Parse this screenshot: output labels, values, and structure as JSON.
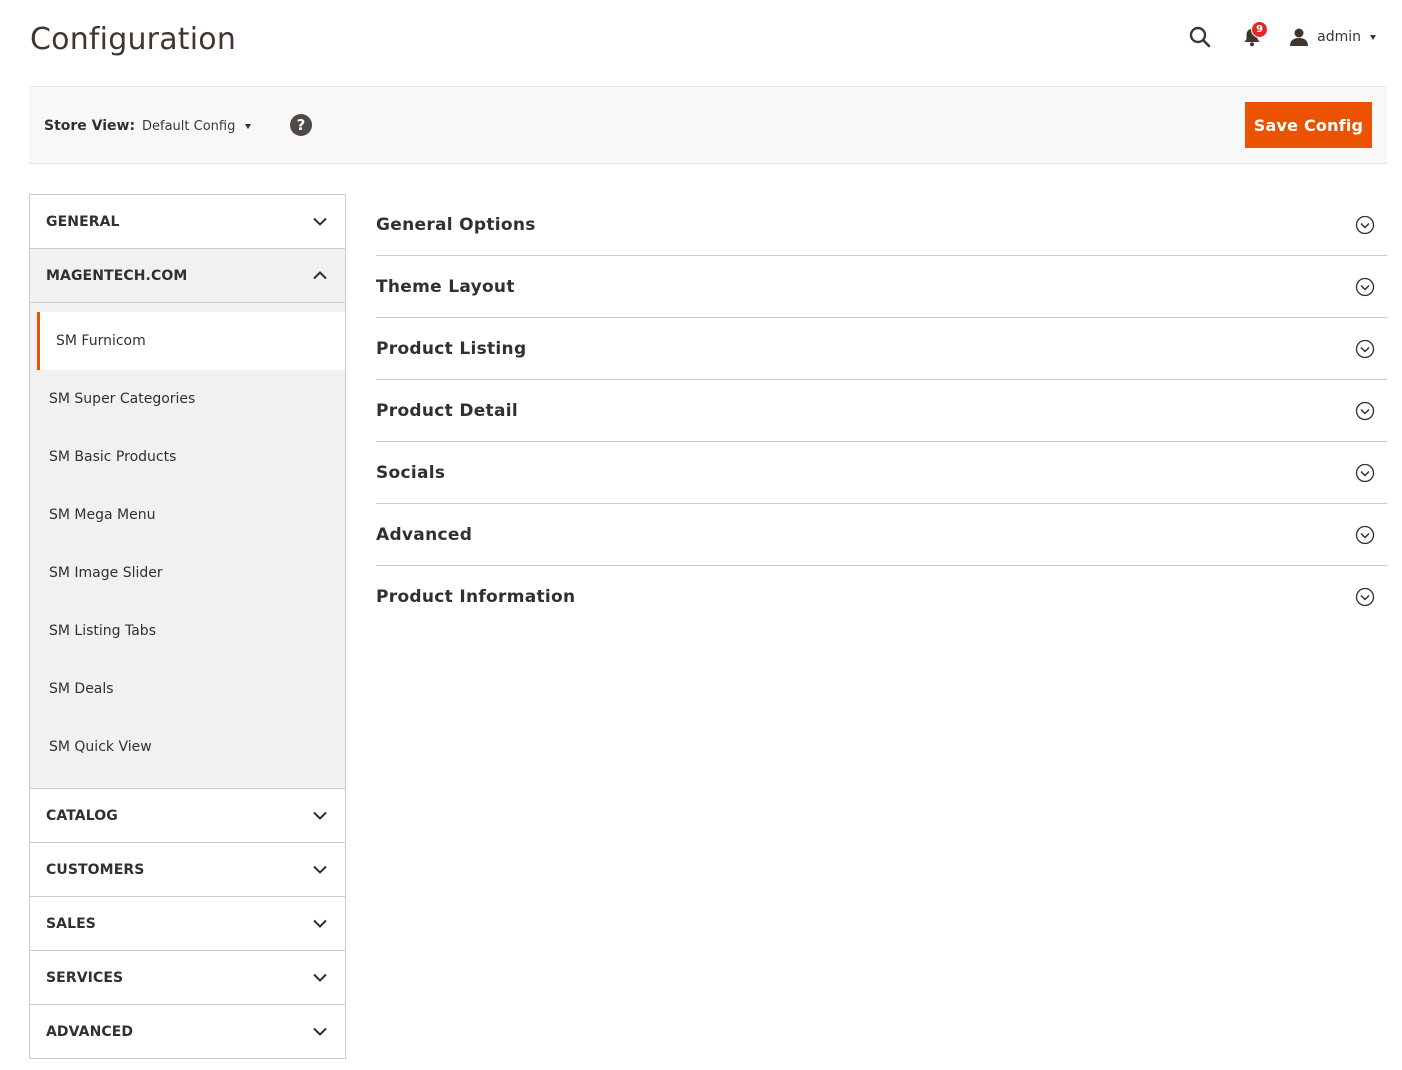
{
  "header": {
    "title": "Configuration",
    "notifications_count": "9",
    "user_name": "admin"
  },
  "store_bar": {
    "label": "Store View:",
    "value": "Default Config",
    "help": "?",
    "save_label": "Save Config"
  },
  "sidebar": {
    "tabs": [
      {
        "title": "GENERAL",
        "open": false
      },
      {
        "title": "MAGENTECH.COM",
        "open": true,
        "items": [
          {
            "label": "SM Furnicom",
            "active": true
          },
          {
            "label": "SM Super Categories",
            "active": false
          },
          {
            "label": "SM Basic Products",
            "active": false
          },
          {
            "label": "SM Mega Menu",
            "active": false
          },
          {
            "label": "SM Image Slider",
            "active": false
          },
          {
            "label": "SM Listing Tabs",
            "active": false
          },
          {
            "label": "SM Deals",
            "active": false
          },
          {
            "label": "SM Quick View",
            "active": false
          }
        ]
      },
      {
        "title": "CATALOG",
        "open": false
      },
      {
        "title": "CUSTOMERS",
        "open": false
      },
      {
        "title": "SALES",
        "open": false
      },
      {
        "title": "SERVICES",
        "open": false
      },
      {
        "title": "ADVANCED",
        "open": false
      }
    ]
  },
  "sections": [
    "General Options",
    "Theme Layout",
    "Product Listing",
    "Product Detail",
    "Socials",
    "Advanced",
    "Product Information"
  ],
  "colors": {
    "accent": "#eb5202",
    "text": "#303030",
    "badge": "#e22626"
  }
}
